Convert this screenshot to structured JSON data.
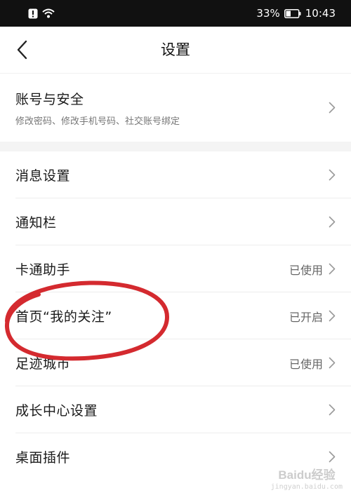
{
  "status_bar": {
    "battery_percent": "33%",
    "time": "10:43"
  },
  "nav": {
    "title": "设置"
  },
  "account": {
    "label": "账号与安全",
    "sub": "修改密码、修改手机号码、社交账号绑定"
  },
  "items": [
    {
      "label": "消息设置",
      "value": ""
    },
    {
      "label": "通知栏",
      "value": ""
    },
    {
      "label": "卡通助手",
      "value": "已使用"
    },
    {
      "label": "首页“我的关注”",
      "value": "已开启"
    },
    {
      "label": "足迹城市",
      "value": "已使用"
    },
    {
      "label": "成长中心设置",
      "value": ""
    },
    {
      "label": "桌面插件",
      "value": ""
    }
  ],
  "annotation": {
    "color": "#d42a2f"
  },
  "watermark": {
    "logo_text": "Baidu经验",
    "sub": "jingyan.baidu.com"
  }
}
